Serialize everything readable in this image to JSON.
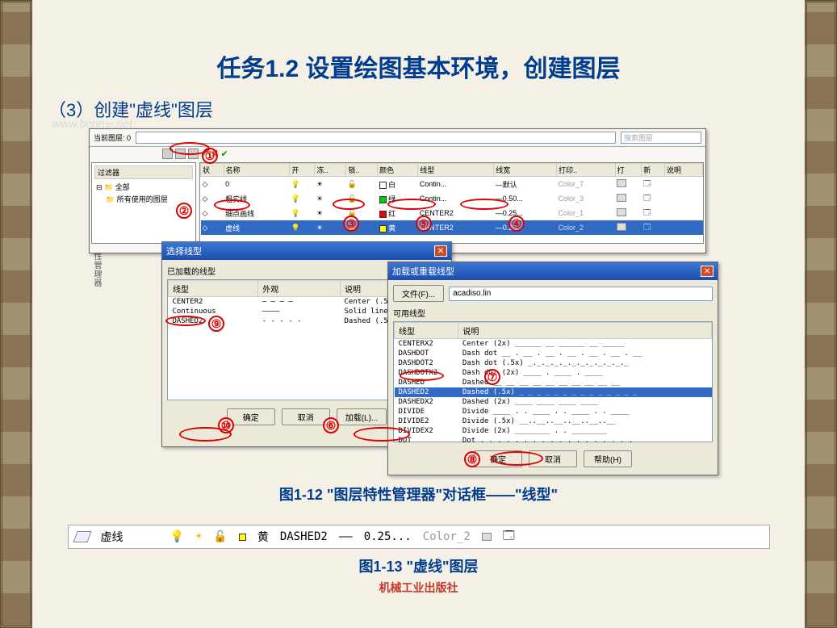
{
  "title": "任务1.2  设置绘图基本环境，创建图层",
  "subtitle": "（3）创建\"虚线\"图层",
  "watermark": "www.bonnie.net",
  "layer_manager": {
    "current_label": "当前图层: 0",
    "search_placeholder": "搜索图层",
    "tree_header": "过滤器",
    "tree_root": "全部",
    "tree_child": "所有使用的图层",
    "columns": [
      "状",
      "名称",
      "开",
      "冻..",
      "锁..",
      "颜色",
      "线型",
      "线宽",
      "打印..",
      "打",
      "新",
      "说明"
    ],
    "rows": [
      {
        "name": "0",
        "color": "白",
        "swatch": "c-white",
        "ltype": "Contin...",
        "lw": "—默认",
        "plot": "Color_7"
      },
      {
        "name": "粗实线",
        "color": "绿",
        "swatch": "c-green",
        "ltype": "Contin...",
        "lw": "—0.50...",
        "plot": "Color_3"
      },
      {
        "name": "细点画线",
        "color": "红",
        "swatch": "c-red",
        "ltype": "CENTER2",
        "lw": "—0.25...",
        "plot": "Color_1"
      },
      {
        "name": "虚线",
        "color": "黄",
        "swatch": "c-yellow",
        "ltype": "CENTER2",
        "lw": "—0.25...",
        "plot": "Color_2",
        "selected": true
      }
    ]
  },
  "select_dialog": {
    "title": "选择线型",
    "loaded_label": "已加载的线型",
    "columns": [
      "线型",
      "外观",
      "说明"
    ],
    "rows": [
      {
        "name": "CENTER2",
        "pattern": "— — — —",
        "desc": "Center (.5x)"
      },
      {
        "name": "Continuous",
        "pattern": "————",
        "desc": "Solid line"
      },
      {
        "name": "DASHED2",
        "pattern": "- - - - -",
        "desc": "Dashed (.5x)"
      }
    ],
    "ok": "确定",
    "cancel": "取消",
    "load": "加载(L)..."
  },
  "load_dialog": {
    "title": "加载或重载线型",
    "file_btn": "文件(F)...",
    "file_value": "acadiso.lin",
    "avail_label": "可用线型",
    "columns": [
      "线型",
      "说明"
    ],
    "rows": [
      {
        "name": "CENTERX2",
        "desc": "Center (2x) ______  __  ______  __  _____"
      },
      {
        "name": "DASHDOT",
        "desc": "Dash dot __ . __ . __ . __ . __ . __ . __"
      },
      {
        "name": "DASHDOT2",
        "desc": "Dash dot (.5x) _._._._._._._._._._._._"
      },
      {
        "name": "DASHDOTX2",
        "desc": "Dash dot (2x) ____  .  ____  .  ____"
      },
      {
        "name": "DASHED",
        "desc": "Dashed __ __ __ __ __ __ __ __ __ __"
      },
      {
        "name": "DASHED2",
        "desc": "Dashed (.5x) _ _ _ _ _ _ _ _ _ _ _ _ _ _",
        "selected": true
      },
      {
        "name": "DASHEDX2",
        "desc": "Dashed (2x) ____  ____  ____  ____"
      },
      {
        "name": "DIVIDE",
        "desc": "Divide ____ . . ____ . . ____ . . ____"
      },
      {
        "name": "DIVIDE2",
        "desc": "Divide (.5x) __..__..__..__..__..__"
      },
      {
        "name": "DIVIDEX2",
        "desc": "Divide (2x) ________  .  .  ________"
      },
      {
        "name": "DOT",
        "desc": "Dot . . . . . . . . . . . . . . . . . ."
      }
    ],
    "ok": "确定",
    "cancel": "取消",
    "help": "帮助(H)"
  },
  "caption1": "图1-12 \"图层特性管理器\"对话框——\"线型\"",
  "summary": {
    "name": "虚线",
    "color": "黄",
    "ltype": "DASHED2",
    "lw": "0.25...",
    "plot": "Color_2"
  },
  "caption2": "图1-13 \"虚线\"图层",
  "publisher": "机械工业出版社",
  "sidetext": "图层特性管理器",
  "annotations": [
    "①",
    "②",
    "③",
    "④",
    "⑤",
    "⑥",
    "⑦",
    "⑧",
    "⑨",
    "⑩"
  ]
}
